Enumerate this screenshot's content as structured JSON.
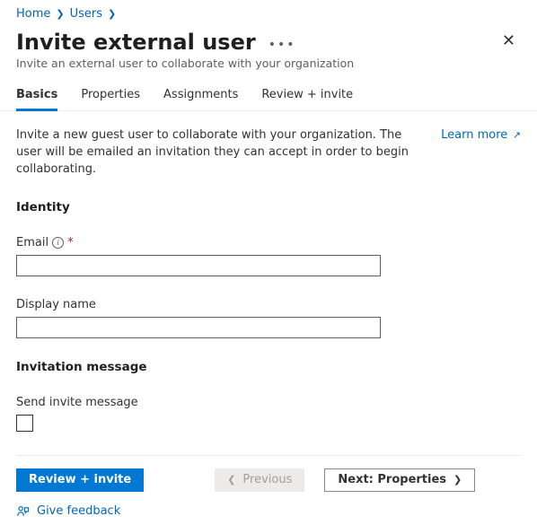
{
  "breadcrumb": {
    "items": [
      "Home",
      "Users"
    ]
  },
  "header": {
    "title": "Invite external user",
    "subtitle": "Invite an external user to collaborate with your organization"
  },
  "tabs": {
    "items": [
      {
        "label": "Basics",
        "active": true
      },
      {
        "label": "Properties",
        "active": false
      },
      {
        "label": "Assignments",
        "active": false
      },
      {
        "label": "Review + invite",
        "active": false
      }
    ]
  },
  "intro": {
    "text": "Invite a new guest user to collaborate with your organization. The user will be emailed an invitation they can accept in order to begin collaborating.",
    "learn_more": "Learn more"
  },
  "sections": {
    "identity": "Identity",
    "invitation": "Invitation message"
  },
  "fields": {
    "email": {
      "label": "Email",
      "required": "*",
      "value": ""
    },
    "display_name": {
      "label": "Display name",
      "value": ""
    },
    "send_invite": {
      "label": "Send invite message",
      "checked": false
    }
  },
  "footer": {
    "review": "Review + invite",
    "previous": "Previous",
    "next": "Next: Properties"
  },
  "feedback": {
    "label": "Give feedback"
  }
}
